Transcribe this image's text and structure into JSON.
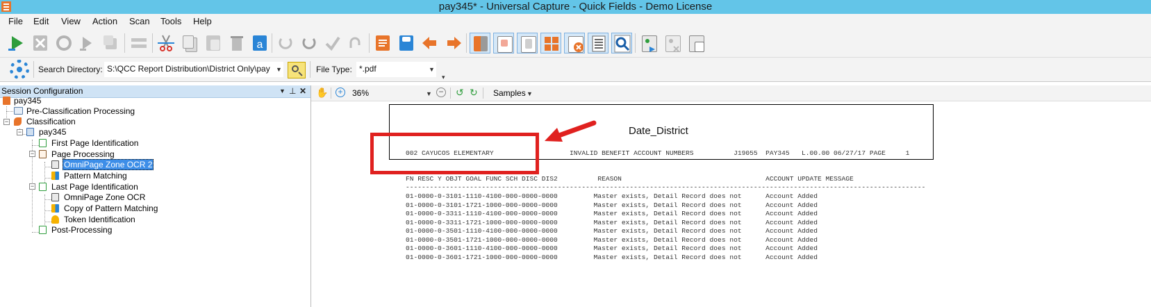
{
  "window": {
    "title": "pay345* - Universal Capture - Quick Fields - Demo License"
  },
  "menu": [
    "File",
    "Edit",
    "View",
    "Action",
    "Scan",
    "Tools",
    "Help"
  ],
  "toolbar": {
    "icons": [
      "run-icon",
      "stop-icon",
      "step-icon",
      "step-over-icon",
      "copy-session-icon",
      "list-icon",
      "cut-icon",
      "copy-icon",
      "paste-icon",
      "delete-icon",
      "rename-icon",
      "rotate-left-icon",
      "rotate-right-icon",
      "approve-icon",
      "redo-icon",
      "report-icon",
      "save-icon",
      "import-icon",
      "export-icon",
      "panel-toggle-icon",
      "page-view-icon",
      "thumbnail-icon",
      "tiles-icon",
      "close-docs-icon",
      "text-view-icon",
      "search-view-icon",
      "scan-icon",
      "scan-disabled-icon",
      "batch-icon"
    ]
  },
  "search": {
    "label": "Search Directory:",
    "value": "S:\\QCC Report Distribution\\District Only\\pay",
    "file_type_label": "File Type:",
    "file_type_value": "*.pdf"
  },
  "session": {
    "title": "Session Configuration",
    "tree": [
      {
        "label": "pay345",
        "icon": "session-icon"
      },
      {
        "label": "Pre-Classification Processing",
        "icon": "pre-class-icon"
      },
      {
        "label": "Classification",
        "icon": "classification-icon"
      },
      {
        "label": "pay345",
        "icon": "document-class-icon"
      },
      {
        "label": "First Page Identification",
        "icon": "first-page-icon"
      },
      {
        "label": "Page Processing",
        "icon": "page-processing-icon"
      },
      {
        "label": "OmniPage Zone OCR 2",
        "icon": "ocr-zone-icon"
      },
      {
        "label": "Pattern Matching",
        "icon": "pattern-icon"
      },
      {
        "label": "Last Page Identification",
        "icon": "last-page-icon"
      },
      {
        "label": "OmniPage Zone OCR",
        "icon": "ocr-zone-icon"
      },
      {
        "label": "Copy of Pattern Matching",
        "icon": "pattern-icon"
      },
      {
        "label": "Token Identification",
        "icon": "token-icon"
      },
      {
        "label": "Post-Processing",
        "icon": "post-processing-icon"
      }
    ]
  },
  "viewer": {
    "zoom": "36%",
    "samples_label": "Samples",
    "zone_name": "Date_District",
    "doc_lines": [
      "002 CAYUCOS ELEMENTARY                   INVALID BENEFIT ACCOUNT NUMBERS          J19055  PAY345   L.00.00 06/27/17 PAGE     1",
      "",
      "FN RESC Y OBJT GOAL FUNC SCH DISC DIS2          REASON                                    ACCOUNT UPDATE MESSAGE",
      "----------------------------------------------------------------------------------------------------------------------------------",
      "01-0000-0-3101-1110-4100-000-0000-0000         Master exists, Detail Record does not      Account Added",
      "01-0000-0-3101-1721-1000-000-0000-0000         Master exists, Detail Record does not      Account Added",
      "01-0000-0-3311-1110-4100-000-0000-0000         Master exists, Detail Record does not      Account Added",
      "01-0000-0-3311-1721-1000-000-0000-0000         Master exists, Detail Record does not      Account Added",
      "01-0000-0-3501-1110-4100-000-0000-0000         Master exists, Detail Record does not      Account Added",
      "01-0000-0-3501-1721-1000-000-0000-0000         Master exists, Detail Record does not      Account Added",
      "01-0000-0-3601-1110-4100-000-0000-0000         Master exists, Detail Record does not      Account Added",
      "01-0000-0-3601-1721-1000-000-0000-0000         Master exists, Detail Record does not      Account Added"
    ]
  },
  "colors": {
    "titlebar": "#63c5e8",
    "selection": "#3d8ee8",
    "annotation_red": "#e0211f",
    "accent_blue": "#2a85d6"
  }
}
